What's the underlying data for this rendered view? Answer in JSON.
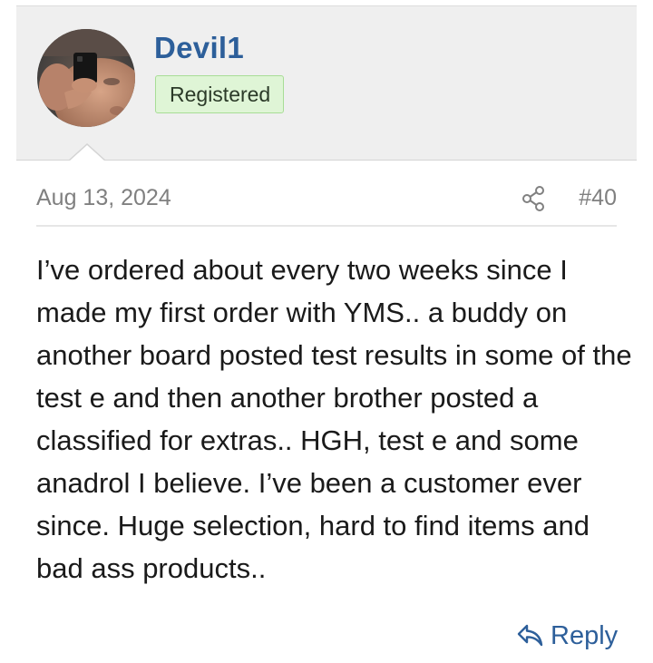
{
  "user": {
    "name": "Devil1",
    "role": "Registered"
  },
  "post": {
    "date": "Aug 13, 2024",
    "number": "#40",
    "body": "I’ve ordered about every two weeks since I made my first order with YMS.. a buddy on another board posted test results in some of the test e and then another brother posted a classified for extras.. HGH, test e and some anadrol I believe. I’ve been a customer ever since. Huge selection, hard to find items and bad ass products..",
    "reply_label": "Reply"
  },
  "icons": {
    "share": "share-icon",
    "reply": "reply-arrow-icon"
  },
  "colors": {
    "username": "#2d5f9a",
    "badge_bg": "#dff5d6",
    "badge_border": "#a8dd96",
    "header_bg": "#efefef",
    "meta_text": "#808080",
    "link": "#2d5f9a"
  }
}
